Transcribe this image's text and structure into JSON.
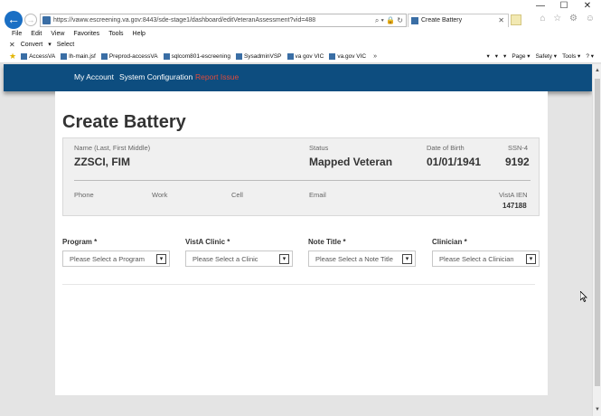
{
  "browser": {
    "url": "https://vaww.escreening.va.gov:8443/sde-stage1/dashboard/editVeteranAssessment?vid=488",
    "tab_title": "Create Battery",
    "address_tools": "⌕ ▾ 🔒 ↻",
    "window_controls": [
      "—",
      "☐",
      "✕"
    ],
    "back_glyph": "←",
    "forward_glyph": "→",
    "tab_close": "✕",
    "ie_icons": "⌂ ☆ ⚙ ☺"
  },
  "menubar": {
    "items": [
      "File",
      "Edit",
      "View",
      "Favorites",
      "Tools",
      "Help"
    ]
  },
  "commandbar": {
    "close_glyph": "✕",
    "convert_label": "Convert",
    "convert_arrow": "▾",
    "select_label": "Select"
  },
  "favorites": {
    "star_glyph": "★",
    "items": [
      "AccessVA",
      "lh-main.jsf",
      "Preprod-accessVA",
      "sqlcom801-escreening",
      "SysadminVSP",
      "va gov VIC",
      "va.gov VIC"
    ],
    "more_glyph": "»",
    "right_tools": [
      "▾",
      "▾",
      "▾",
      "Page ▾",
      "Safety ▾",
      "Tools ▾",
      "? ▾"
    ]
  },
  "nav": {
    "my_account": "My Account",
    "system_configuration": "System Configuration",
    "report_issue": "Report Issue"
  },
  "page": {
    "title": "Create Battery"
  },
  "veteran": {
    "name_label": "Name (Last, First Middle)",
    "name": "ZZSCI, FIM",
    "status_label": "Status",
    "status": "Mapped Veteran",
    "dob_label": "Date of Birth",
    "dob": "01/01/1941",
    "ssn_label": "SSN-4",
    "ssn": "9192",
    "phone_label": "Phone",
    "work_label": "Work",
    "cell_label": "Cell",
    "email_label": "Email",
    "ien_label": "VistA IEN",
    "ien": "147188"
  },
  "form": {
    "program_label": "Program",
    "program_placeholder": "Please Select a Program",
    "clinic_label": "VistA Clinic",
    "clinic_placeholder": "Please Select a Clinic",
    "note_label": "Note Title",
    "note_placeholder": "Please Select a Note Title",
    "clinician_label": "Clinician",
    "clinician_placeholder": "Please Select a Clinician",
    "required_marker": "*",
    "arrow_glyph": "▾"
  },
  "scrollbar": {
    "up": "▲",
    "down": "▼"
  },
  "colors": {
    "navbar": "#0d4d7f",
    "report_issue": "#e04b3c",
    "back_button": "#1a6fc4"
  }
}
